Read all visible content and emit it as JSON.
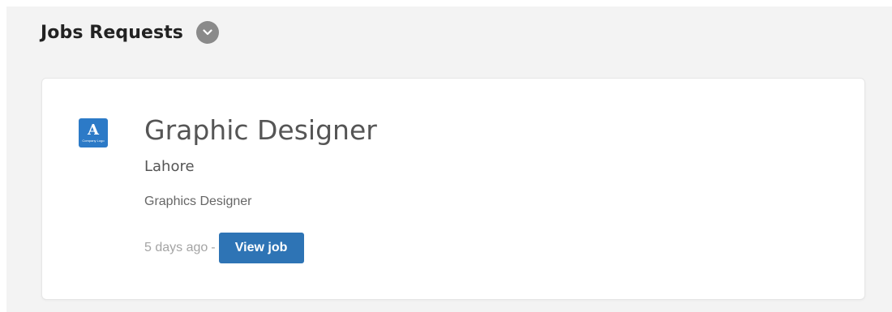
{
  "header": {
    "title": "Jobs Requests",
    "toggle_icon": "chevron-down-icon"
  },
  "jobs": [
    {
      "logo": {
        "letter": "A",
        "caption": "Company Logo",
        "color": "#2c7ac7"
      },
      "title": "Graphic Designer",
      "location": "Lahore",
      "category": "Graphics Designer",
      "posted": "5 days ago",
      "separator": "-",
      "view_label": "View job"
    }
  ],
  "colors": {
    "panel_bg": "#f3f3f3",
    "card_bg": "#ffffff",
    "accent": "#2e74b5",
    "toggle_bg": "#8a8a8a"
  }
}
